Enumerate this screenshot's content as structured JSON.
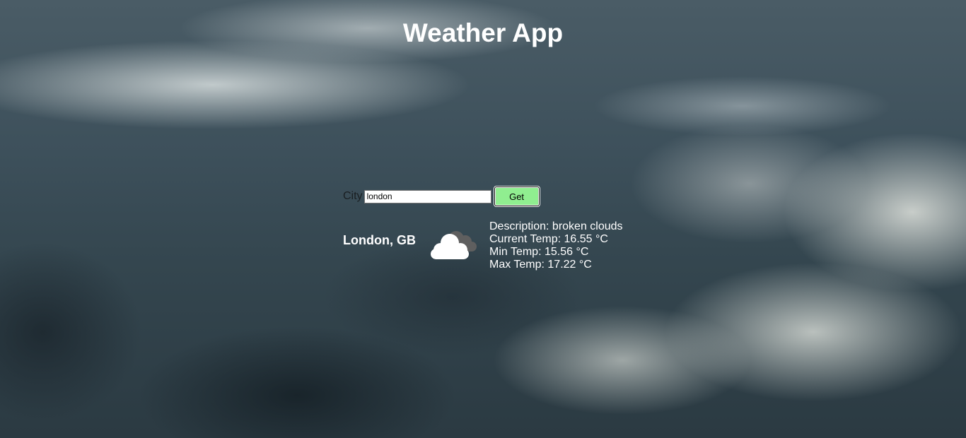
{
  "app": {
    "title": "Weather App"
  },
  "form": {
    "city_label": "City",
    "city_value": "london",
    "get_label": "Get"
  },
  "result": {
    "location": "London, GB",
    "icon": "broken-clouds-icon",
    "description": "Description: broken clouds",
    "current_temp": "Current Temp: 16.55 °C",
    "min_temp": "Min Temp: 15.56 °C",
    "max_temp": "Max Temp: 17.22 °C"
  },
  "colors": {
    "button_bg": "#90ee90",
    "text": "#ffffff"
  }
}
